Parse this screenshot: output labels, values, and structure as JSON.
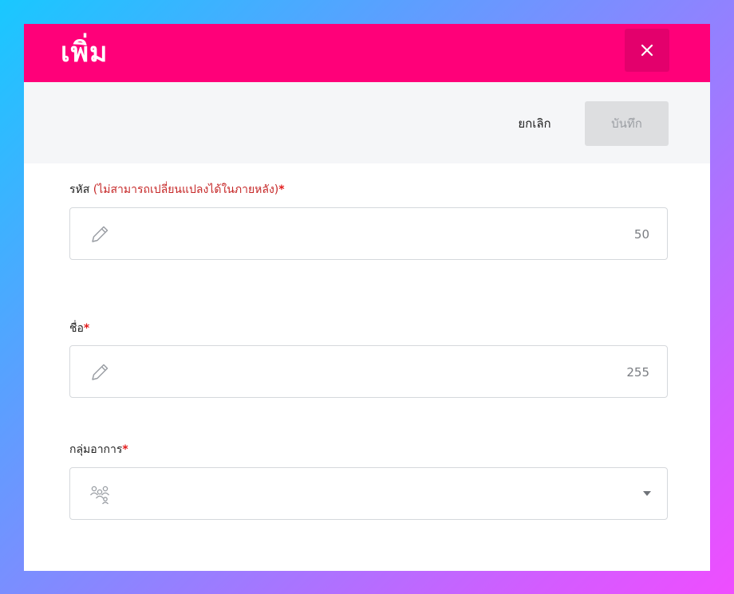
{
  "dialog": {
    "title": "เพิ่ม",
    "close_icon": "close-icon"
  },
  "toolbar": {
    "cancel_label": "ยกเลิก",
    "save_label": "บันทึก"
  },
  "fields": {
    "code": {
      "label": "รหัส",
      "note": "(ไม่สามารถเปลี่ยนแปลงได้ในภายหลัง)",
      "required_mark": "*",
      "value": "",
      "counter": "50",
      "icon": "pencil-icon"
    },
    "name": {
      "label": "ชื่อ",
      "required_mark": "*",
      "value": "",
      "counter": "255",
      "icon": "pencil-icon"
    },
    "symptom_group": {
      "label": "กลุ่มอาการ",
      "required_mark": "*",
      "selected": "",
      "icon": "users-group-icon",
      "dropdown_icon": "caret-down-icon"
    }
  },
  "colors": {
    "header": "#ff0079",
    "close_button": "#e3006c",
    "toolbar_bg": "#f5f6f8",
    "save_disabled_bg": "#dddee0",
    "note_text": "#c62828",
    "required_mark": "#e21b1b"
  }
}
